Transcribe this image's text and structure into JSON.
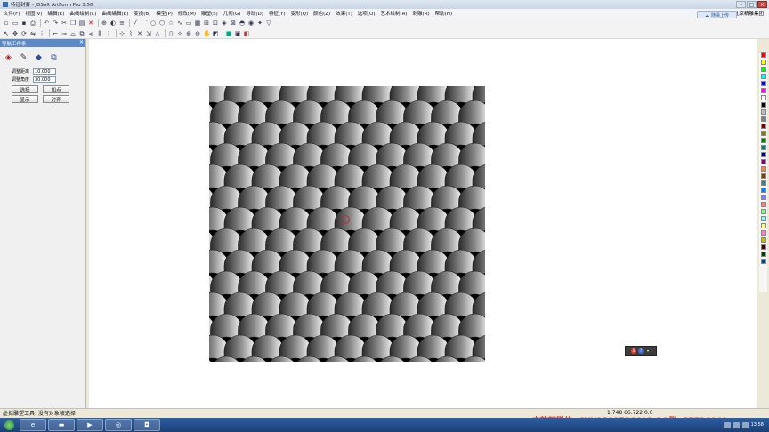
{
  "window": {
    "title": "特征封套 - JDSoft ArtForm Pro 3.50",
    "controls": [
      "–",
      "□",
      "×"
    ]
  },
  "menu": {
    "items": [
      "文件(F)",
      "视图(V)",
      "编辑(E)",
      "曲线绘制(C)",
      "曲线编辑(E)",
      "变换(B)",
      "模型(P)",
      "修改(M)",
      "雕塑(S)",
      "几何(G)",
      "导动(D)",
      "特征(Y)",
      "变形(Q)",
      "颜色(Z)",
      "效果(T)",
      "选项(O)",
      "艺术绘制(A)",
      "刺雕(R)",
      "帮助(H)"
    ],
    "right_label": "北京精雕集团"
  },
  "cloud_button": {
    "label": "随缘上传"
  },
  "toolbar": {
    "row1_icons": [
      "new-icon",
      "open-icon",
      "save-icon",
      "print-icon",
      "undo-icon",
      "redo-icon",
      "cut-icon",
      "copy-icon",
      "paste-icon",
      "delete-icon",
      "zoom-icon",
      "shade-icon",
      "layer-icon",
      "line-icon",
      "arc-icon",
      "circle-icon",
      "polygon-icon",
      "star-icon",
      "spline-icon"
    ],
    "row2_icons": [
      "select-icon",
      "move-icon",
      "rotate-icon",
      "mirror-icon",
      "array-icon",
      "trim-icon",
      "extend-icon",
      "fillet-icon",
      "offset-icon",
      "color-icon"
    ]
  },
  "left_panel": {
    "header": "导航工作条",
    "tool_icons": [
      "envelope-icon",
      "edit-envelope-icon",
      "fit-icon",
      "align-icon"
    ],
    "fields": [
      {
        "label": "调整距离",
        "value": "10.000"
      },
      {
        "label": "调整角度",
        "value": "30.000"
      }
    ],
    "buttons": [
      {
        "label": "选择"
      },
      {
        "label": "加点"
      },
      {
        "label": "显示"
      },
      {
        "label": "对齐"
      }
    ]
  },
  "palette": {
    "colors": [
      "#ff0000",
      "#ffff00",
      "#00ff00",
      "#00ffff",
      "#0000ff",
      "#ff00ff",
      "#ffffff",
      "#000000",
      "#c0c0c0",
      "#808080",
      "#800000",
      "#808000",
      "#008000",
      "#008080",
      "#000080",
      "#800080",
      "#ff8040",
      "#804000",
      "#408080",
      "#0080ff",
      "#8080ff",
      "#ff8080",
      "#80ff80",
      "#80ffff",
      "#ffff80",
      "#ff80c0",
      "#c0c000",
      "#400000",
      "#004000",
      "#004080"
    ]
  },
  "status": {
    "message": "虚拟雕塑工具: 没有对象被选择",
    "coordinates": "1.748  66.722  0.0"
  },
  "watermark": "古韵轩微信: GYX1582736692  QQ群: 57716041..",
  "taskbar": {
    "apps": [
      "ie-icon",
      "folder-icon",
      "media-icon",
      "app-icon",
      "jdsoft-icon"
    ],
    "time": "13:58"
  }
}
